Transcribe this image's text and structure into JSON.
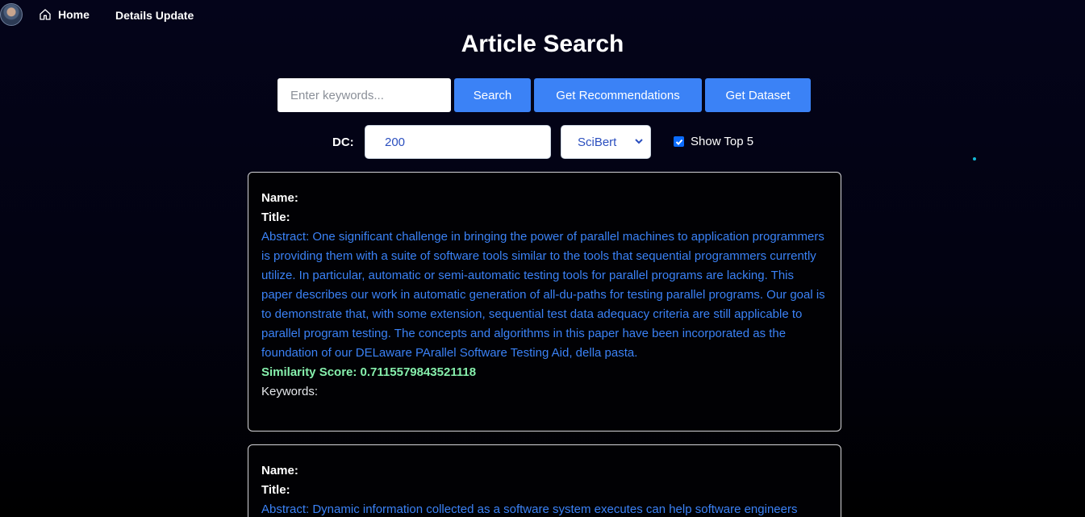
{
  "nav": {
    "home_label": "Home",
    "details_label": "Details Update"
  },
  "page_title": "Article Search",
  "search": {
    "placeholder": "Enter keywords...",
    "value": ""
  },
  "buttons": {
    "search": "Search",
    "recommendations": "Get Recommendations",
    "dataset": "Get Dataset"
  },
  "options": {
    "dc_label": "DC:",
    "dc_value": "200",
    "model_value": "SciBert",
    "show_top5_label": "Show Top 5",
    "show_top5_checked": true
  },
  "results": [
    {
      "name_label": "Name:",
      "title_label": "Title:",
      "abstract": "Abstract: One significant challenge in bringing the power of parallel machines to application programmers is providing them with a suite of software tools similar to the tools that sequential programmers currently utilize. In particular, automatic or semi-automatic testing tools for parallel programs are lacking. This paper describes our work in automatic generation of all-du-paths for testing parallel programs. Our goal is to demonstrate that, with some extension, sequential test data adequacy criteria are still applicable to parallel program testing. The concepts and algorithms in this paper have been incorporated as the foundation of our DELaware PArallel Software Testing Aid, della pasta.",
      "score": "Similarity Score: 0.7115579843521118",
      "keywords": "Keywords:"
    },
    {
      "name_label": "Name:",
      "title_label": "Title:",
      "abstract": "Abstract: Dynamic information collected as a software system executes can help software engineers"
    }
  ],
  "colors": {
    "accent": "#3b82f6",
    "score": "#86efac",
    "background": "#020211"
  },
  "icons": {
    "home": "home-icon",
    "select": "chevron-down-icon",
    "check": "check-icon"
  }
}
